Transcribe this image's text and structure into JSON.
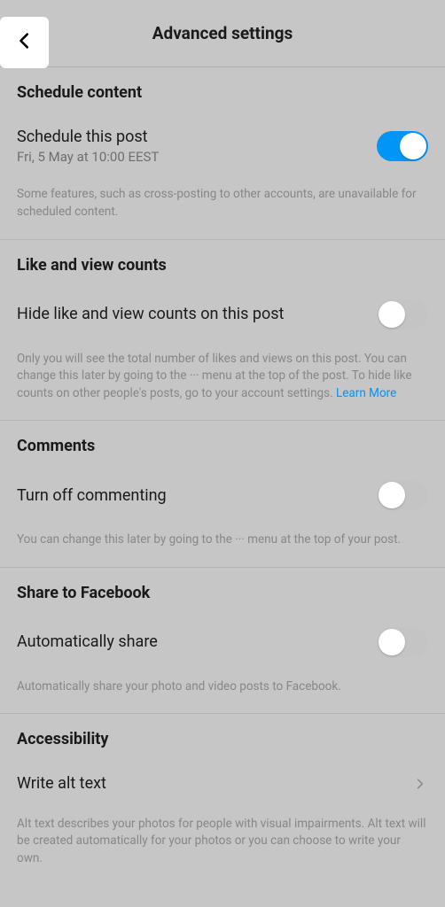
{
  "header": {
    "title": "Advanced settings"
  },
  "sections": {
    "schedule": {
      "title": "Schedule content",
      "option_label": "Schedule this post",
      "option_sub": "Fri, 5 May at 10:00 EEST",
      "toggle_on": true,
      "desc": "Some features, such as cross-posting to other accounts, are unavailable for scheduled content."
    },
    "likes": {
      "title": "Like and view counts",
      "option_label": "Hide like and view counts on this post",
      "toggle_on": false,
      "desc_before": "Only you will see the total number of likes and views on this post. You can change this later by going to the ··· menu at the top of the post. To hide like counts on other people's posts, go to your account settings. ",
      "link_text": "Learn More"
    },
    "comments": {
      "title": "Comments",
      "option_label": "Turn off commenting",
      "toggle_on": false,
      "desc": "You can change this later by going to the ··· menu at the top of your post."
    },
    "facebook": {
      "title": "Share to Facebook",
      "option_label": "Automatically share",
      "toggle_on": false,
      "desc": "Automatically share your photo and video posts to Facebook."
    },
    "accessibility": {
      "title": "Accessibility",
      "option_label": "Write alt text",
      "desc": "Alt text describes your photos for people with visual impairments. Alt text will be created automatically for your photos or you can choose to write your own."
    }
  }
}
